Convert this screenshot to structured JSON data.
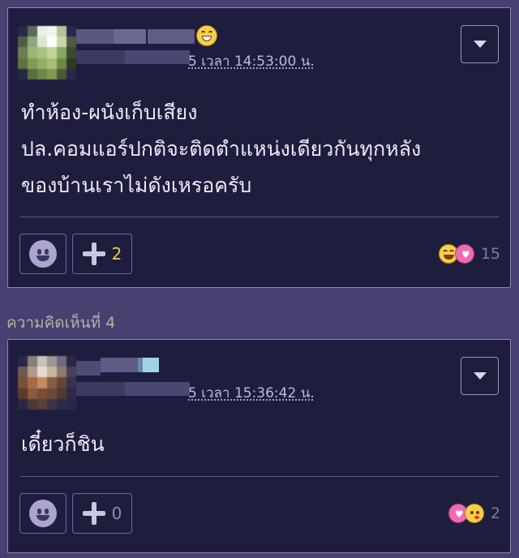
{
  "comments": [
    {
      "time_text": "5 เวลา 14:53:00 น.",
      "body_lines": [
        "ทำห้อง-ผนังเก็บเสียง",
        "ปล.คอมแอร์ปกติจะติดตำแหน่งเดียวกันทุกหลัง",
        "ของบ้านเราไม่ดังเหรอครับ"
      ],
      "plus_count": "2",
      "reaction_count": "15",
      "reaction_icons": [
        "laugh-emoji",
        "love-emoji"
      ]
    },
    {
      "section_label": "ความคิดเห็นที่ 4",
      "time_text": "5 เวลา 15:36:42 น.",
      "body_lines": [
        "เดี๋ยวก็ชิน"
      ],
      "plus_count": "0",
      "reaction_count": "2",
      "reaction_icons": [
        "love-emoji",
        "kiss-emoji"
      ]
    }
  ],
  "colors": {
    "page_bg": "#474070",
    "card_bg": "#1f1d3d",
    "plus_count_active": "#f2c94c",
    "plus_count_inactive": "#8e8ab0"
  }
}
